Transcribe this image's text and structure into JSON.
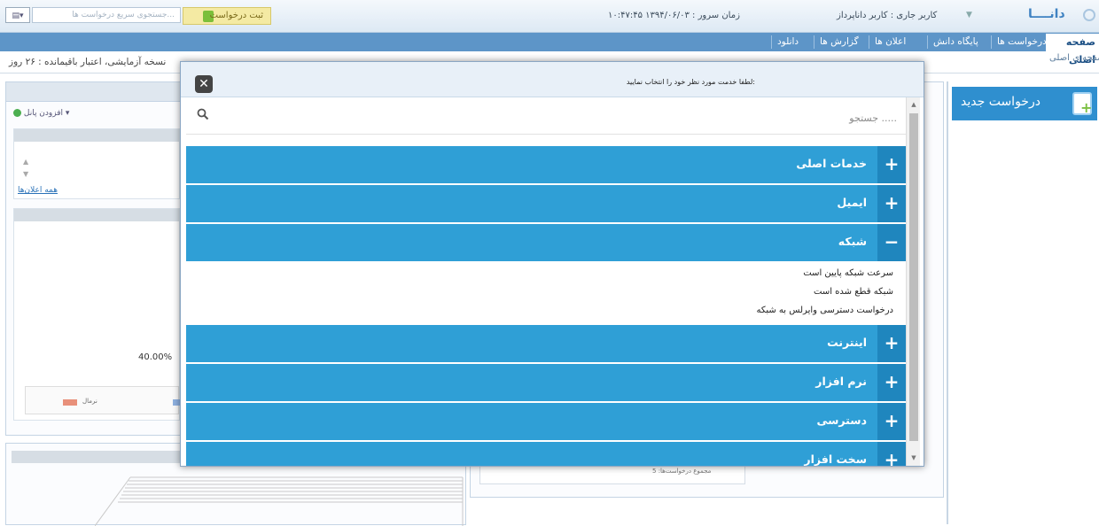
{
  "header": {
    "logo_text": "دانــــا",
    "current_user": "کاربر جاری : کاربر داناپرداز",
    "server_time": "زمان سرور : ۱۳۹۴/۰۶/۰۳ ۱۰:۴۷:۴۵",
    "submit_request_label": "ثبت درخواست",
    "quick_search_placeholder": "جستجوی سریع درخواست ها..."
  },
  "nav": {
    "items": [
      "صفحه اصلی",
      "درخواست ها",
      "پایگاه دانش",
      "اعلان ها",
      "گزارش ها",
      "دانلود"
    ]
  },
  "breadcrumb": "صفحه ی اصلی",
  "trial_notice": "نسخه آزمایشی، اعتبار باقیمانده : ۲۶ روز",
  "add_panel_label": "افزودن پانل",
  "all_announcements_link": "همه اعلان‌ها",
  "chart_percent_label": "40.00%",
  "legend_label": "نرمال",
  "request_count_label": "مجموع درخواست‌ها: 5",
  "new_request_label": "درخواست جدید",
  "modal": {
    "title": "لطفا خدمت مورد نظر خود را انتخاب نمایید:",
    "search_placeholder": "جستجو .....",
    "sections": [
      {
        "label": "خدمات اصلی",
        "icon": "+"
      },
      {
        "label": "ایمیل",
        "icon": "+"
      },
      {
        "label": "شبکه",
        "icon": "−"
      },
      {
        "label": "اینترنت",
        "icon": "+"
      },
      {
        "label": "نرم افزار",
        "icon": "+"
      },
      {
        "label": "دسترسی",
        "icon": "+"
      },
      {
        "label": "سخت افزار",
        "icon": "+"
      }
    ],
    "network_items": [
      "سرعت شبکه پایین است",
      "شبکه قطع شده است",
      "درخواست دسترسی وایرلس به شبکه"
    ]
  },
  "colors": {
    "accordion": "#2f9fd6",
    "accordion_icon": "#1f86be",
    "nav_bar": "#5d95c8",
    "new_request_button": "#2f8fcf"
  }
}
